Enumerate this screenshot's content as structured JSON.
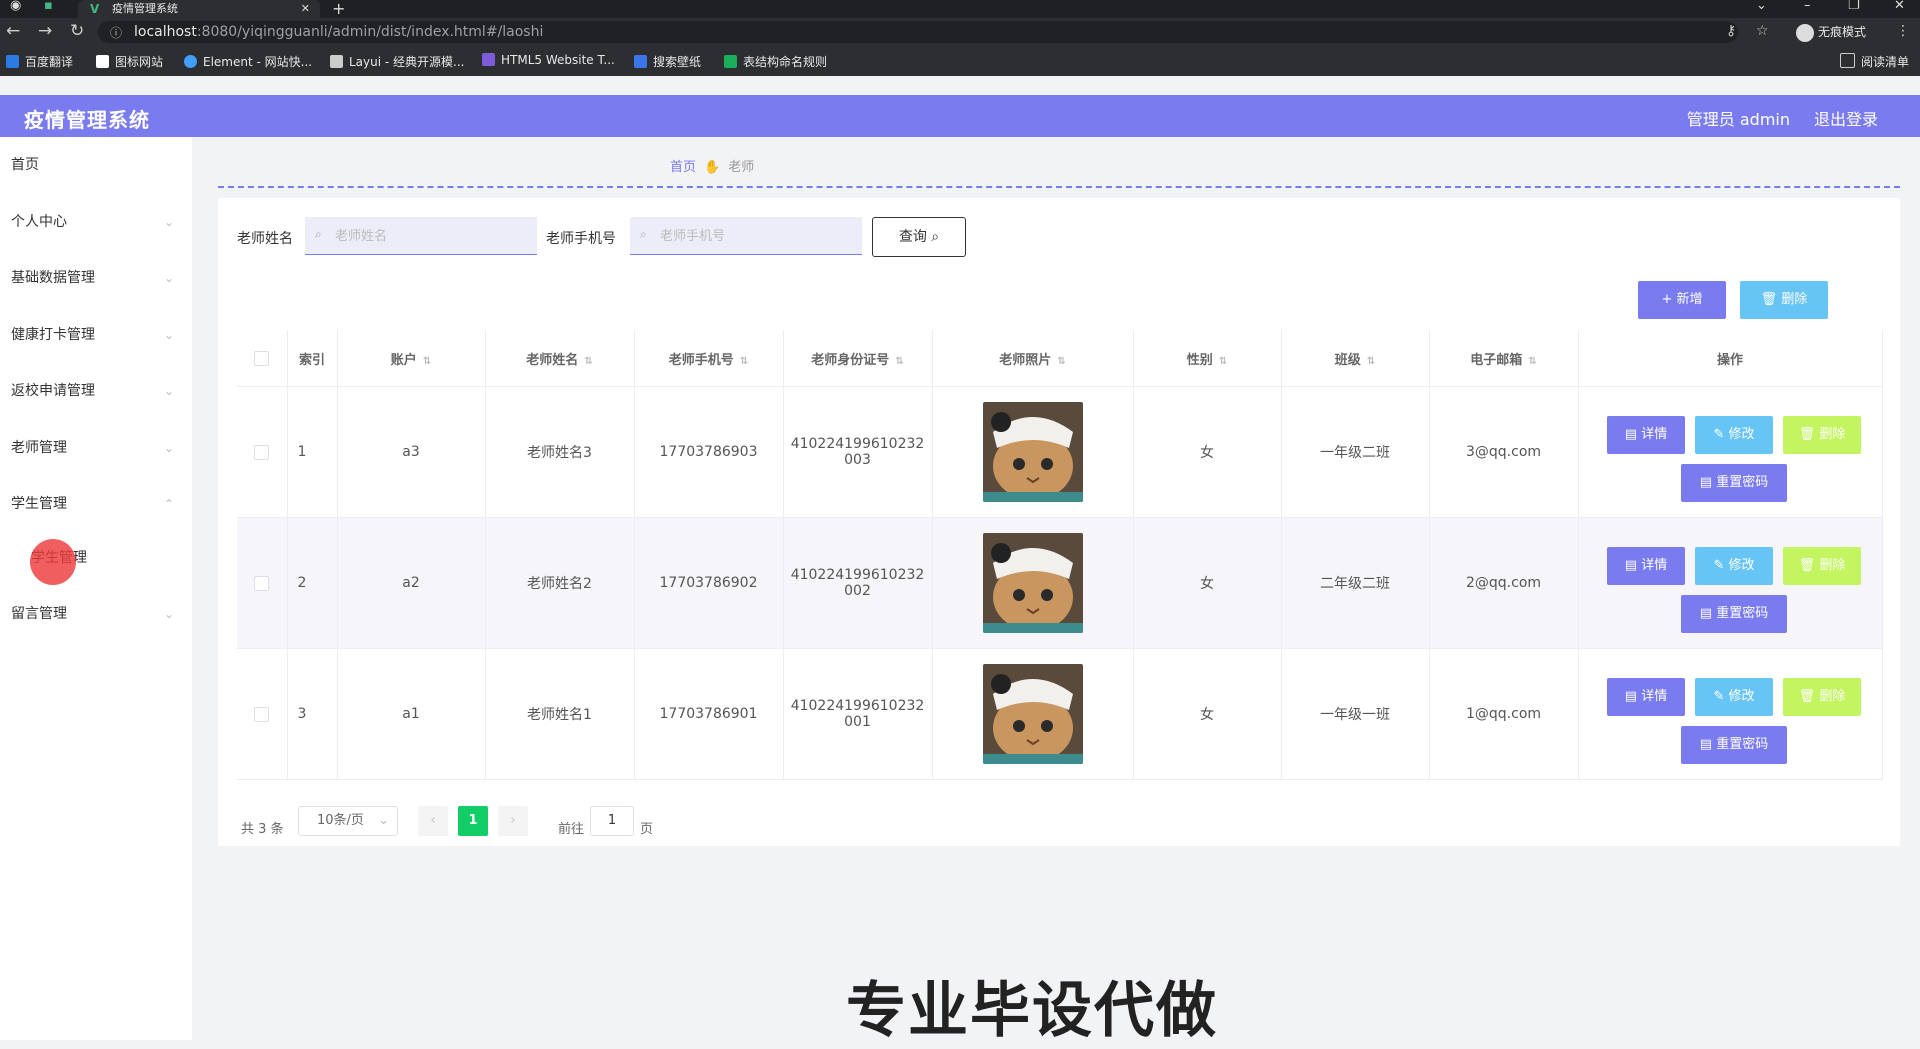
{
  "browser": {
    "tab_title": "疫情管理系统",
    "new_tab": "+",
    "url_host": "localhost",
    "url_path": ":8080/yiqingguanli/admin/dist/index.html#/laoshi",
    "profile": "无痕模式",
    "bookmarks": [
      "百度翻译",
      "图标网站",
      "Element - 网站快...",
      "Layui - 经典开源模...",
      "HTML5 Website T...",
      "搜索壁纸",
      "表结构命名规则"
    ],
    "reading_list": "阅读清单"
  },
  "header": {
    "title": "疫情管理系统",
    "user": "管理员 admin",
    "logout": "退出登录"
  },
  "sidebar": {
    "items": [
      {
        "label": "首页"
      },
      {
        "label": "个人中心"
      },
      {
        "label": "基础数据管理"
      },
      {
        "label": "健康打卡管理"
      },
      {
        "label": "返校申请管理"
      },
      {
        "label": "老师管理"
      },
      {
        "label": "学生管理"
      },
      {
        "label": "留言管理"
      }
    ],
    "sub_item": "学生管理"
  },
  "breadcrumb": {
    "home": "首页",
    "current": "老师"
  },
  "search": {
    "name_label": "老师姓名",
    "name_placeholder": "老师姓名",
    "phone_label": "老师手机号",
    "phone_placeholder": "老师手机号",
    "query_button": "查询"
  },
  "toolbar": {
    "add": "+ 新增",
    "delete": "删除"
  },
  "table": {
    "columns": [
      "索引",
      "账户",
      "老师姓名",
      "老师手机号",
      "老师身份证号",
      "老师照片",
      "性别",
      "班级",
      "电子邮箱",
      "操作"
    ],
    "rows": [
      {
        "index": "1",
        "account": "a3",
        "name": "老师姓名3",
        "phone": "17703786903",
        "id_line1": "410224199610232",
        "id_line2": "003",
        "gender": "女",
        "class": "一年级二班",
        "email": "3@qq.com"
      },
      {
        "index": "2",
        "account": "a2",
        "name": "老师姓名2",
        "phone": "17703786902",
        "id_line1": "410224199610232",
        "id_line2": "002",
        "gender": "女",
        "class": "二年级二班",
        "email": "2@qq.com"
      },
      {
        "index": "3",
        "account": "a1",
        "name": "老师姓名1",
        "phone": "17703786901",
        "id_line1": "410224199610232",
        "id_line2": "001",
        "gender": "女",
        "class": "一年级一班",
        "email": "1@qq.com"
      }
    ],
    "actions": {
      "detail": "详情",
      "edit": "修改",
      "delete": "删除",
      "reset": "重置密码"
    }
  },
  "pagination": {
    "total": "共 3 条",
    "page_size": "10条/页",
    "current_page": "1",
    "goto_label": "前往",
    "goto_value": "1",
    "page_suffix": "页"
  },
  "watermark": "专业毕设代做",
  "colors": {
    "accent": "#7b7bf0",
    "info": "#67c5f5",
    "warn": "#c2f55f",
    "success": "#13ce66"
  }
}
